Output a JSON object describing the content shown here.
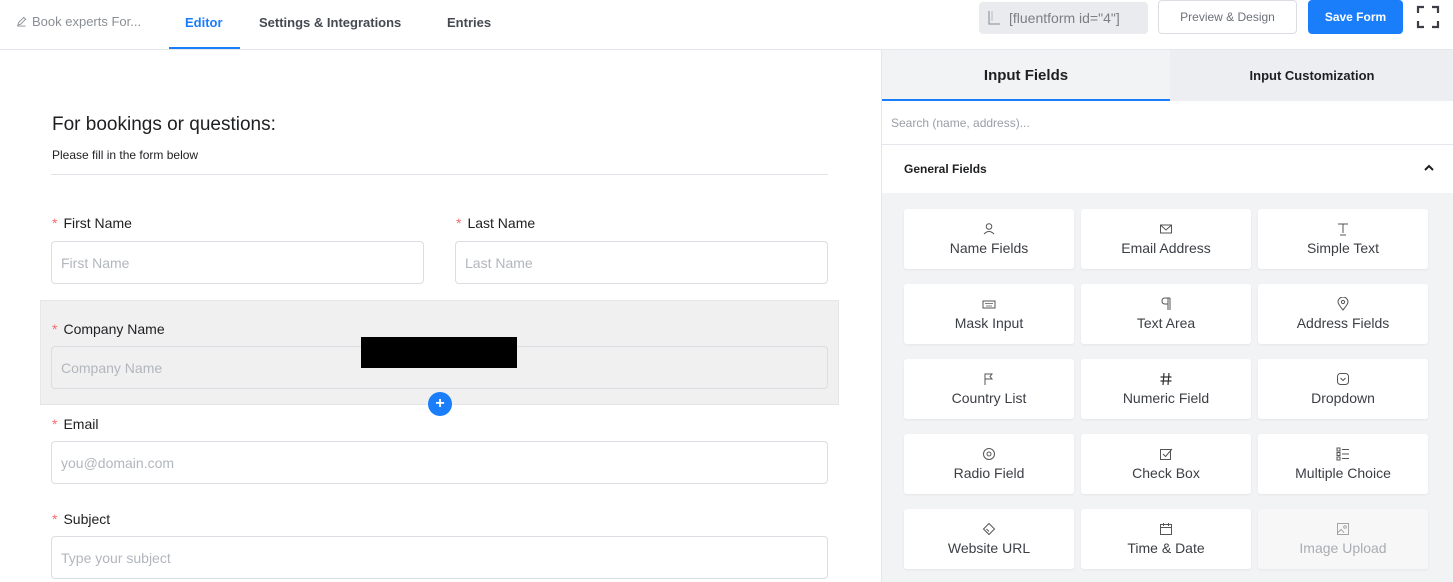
{
  "topbar": {
    "form_name": "Book experts For...",
    "tabs": [
      "Editor",
      "Settings & Integrations",
      "Entries"
    ],
    "shortcode": "[fluentform id=\"4\"]",
    "preview_label": "Preview & Design",
    "save_label": "Save Form"
  },
  "form": {
    "title": "For bookings or questions:",
    "description": "Please fill in the form below",
    "fields": {
      "first_name": {
        "label": "First Name",
        "placeholder": "First Name"
      },
      "last_name": {
        "label": "Last Name",
        "placeholder": "Last Name"
      },
      "company": {
        "label": "Company Name",
        "placeholder": "Company Name"
      },
      "email": {
        "label": "Email",
        "placeholder": "you@domain.com"
      },
      "subject": {
        "label": "Subject",
        "placeholder": "Type your subject"
      }
    },
    "required_marker": "*",
    "add_label": "+"
  },
  "panel": {
    "tabs": [
      "Input Fields",
      "Input Customization"
    ],
    "search_placeholder": "Search (name, address)...",
    "section_title": "General Fields",
    "items": [
      {
        "label": "Name Fields",
        "icon": "user-icon"
      },
      {
        "label": "Email Address",
        "icon": "envelope-icon"
      },
      {
        "label": "Simple Text",
        "icon": "text-cursor-icon"
      },
      {
        "label": "Mask Input",
        "icon": "keyboard-icon"
      },
      {
        "label": "Text Area",
        "icon": "paragraph-icon"
      },
      {
        "label": "Address Fields",
        "icon": "map-pin-icon"
      },
      {
        "label": "Country List",
        "icon": "flag-icon"
      },
      {
        "label": "Numeric Field",
        "icon": "hash-icon"
      },
      {
        "label": "Dropdown",
        "icon": "dropdown-icon"
      },
      {
        "label": "Radio Field",
        "icon": "radio-icon"
      },
      {
        "label": "Check Box",
        "icon": "checkbox-icon"
      },
      {
        "label": "Multiple Choice",
        "icon": "list-icon"
      },
      {
        "label": "Website URL",
        "icon": "link-icon"
      },
      {
        "label": "Time & Date",
        "icon": "calendar-icon"
      },
      {
        "label": "Image Upload",
        "icon": "image-icon"
      }
    ]
  },
  "colors": {
    "accent": "#1a7efb",
    "required": "#f56c6c",
    "panel_bg": "#f2f3f5"
  }
}
